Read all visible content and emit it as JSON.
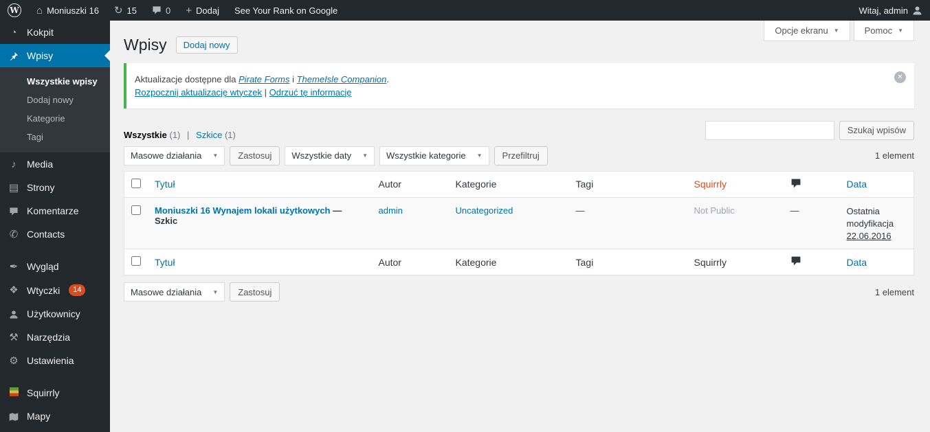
{
  "colors": {
    "accent": "#0073aa",
    "notice_green": "#46b450",
    "badge_red": "#d54e21",
    "squirrly_header": "#d54e21"
  },
  "icons": {
    "wp_logo": "W",
    "home": "⌂",
    "updates": "↻",
    "plus": "+",
    "dropdown_arrow": "▼",
    "dashboard": "◔",
    "media": "♪",
    "pages": "▤",
    "contacts": "✆",
    "appearance": "✒",
    "plugins": "❖",
    "tools": "⚒",
    "settings": "⚙",
    "dismiss": "✕"
  },
  "admin_bar": {
    "site_name": "Moniuszki 16",
    "updates_count": "15",
    "comments_count": "0",
    "new_item": "Dodaj",
    "promo": "See Your Rank on Google",
    "greeting": "Witaj, admin"
  },
  "sidebar": {
    "items": [
      {
        "label": "Kokpit"
      },
      {
        "label": "Wpisy"
      },
      {
        "label": "Media"
      },
      {
        "label": "Strony"
      },
      {
        "label": "Komentarze"
      },
      {
        "label": "Contacts"
      },
      {
        "label": "Wygląd"
      },
      {
        "label": "Wtyczki",
        "badge": "14"
      },
      {
        "label": "Użytkownicy"
      },
      {
        "label": "Narzędzia"
      },
      {
        "label": "Ustawienia"
      },
      {
        "label": "Squirrly"
      },
      {
        "label": "Mapy"
      }
    ],
    "wpisy_submenu": [
      {
        "label": "Wszystkie wpisy",
        "current": true
      },
      {
        "label": "Dodaj nowy",
        "current": false
      },
      {
        "label": "Kategorie",
        "current": false
      },
      {
        "label": "Tagi",
        "current": false
      }
    ]
  },
  "page": {
    "title": "Wpisy",
    "add_new": "Dodaj nowy",
    "screen_options": "Opcje ekranu",
    "help": "Pomoc"
  },
  "notice": {
    "prefix": "Aktualizacje dostępne dla",
    "plugin1": "Pirate Forms",
    "conjunction": "i",
    "plugin2": "ThemeIsle Companion",
    "suffix": ".",
    "update_link": "Rozpocznij aktualizację wtyczek",
    "separator": "|",
    "dismiss_link": "Odrzuć tę informację"
  },
  "filters": {
    "views": [
      {
        "label": "Wszystkie",
        "count": "(1)"
      },
      {
        "label": "Szkice",
        "count": "(1)"
      }
    ],
    "views_separator": "|",
    "search_value": "",
    "search_button": "Szukaj wpisów",
    "bulk_actions": "Masowe działania",
    "apply": "Zastosuj",
    "all_dates": "Wszystkie daty",
    "all_categories": "Wszystkie kategorie",
    "filter": "Przefiltruj",
    "item_count": "1 element"
  },
  "table": {
    "headers": {
      "title": "Tytuł",
      "author": "Autor",
      "categories": "Kategorie",
      "tags": "Tagi",
      "squirrly": "Squirrly",
      "date": "Data"
    },
    "rows": [
      {
        "title": "Moniuszki 16 Wynajem lokali użytkowych",
        "state": "— Szkic",
        "author": "admin",
        "category": "Uncategorized",
        "tags": "—",
        "squirrly": "Not Public",
        "comments": "—",
        "date_label": "Ostatnia modyfikacja",
        "date": "22.06.2016"
      }
    ]
  }
}
